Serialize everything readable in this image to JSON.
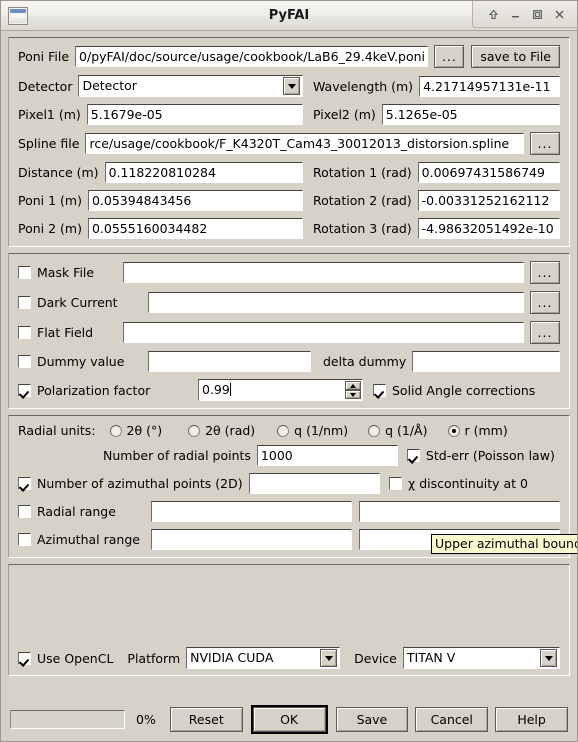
{
  "window": {
    "title": "PyFAI",
    "icon": "window-icon",
    "controls": [
      {
        "name": "shade-button",
        "glyph": "up-arrow-icon"
      },
      {
        "name": "minimize-button",
        "glyph": "minimize-icon"
      },
      {
        "name": "maximize-button",
        "glyph": "maximize-icon"
      },
      {
        "name": "close-button",
        "glyph": "close-icon"
      }
    ]
  },
  "geometry": {
    "poni_file_label": "Poni File",
    "poni_file_value": "0/pyFAI/doc/source/usage/cookbook/LaB6_29.4keV.poni",
    "browse_label": "...",
    "save_to_file_label": "save to File",
    "detector_label": "Detector",
    "detector_value": "Detector",
    "wavelength_label": "Wavelength (m)",
    "wavelength_value": "4.21714957131e-11",
    "pixel1_label": "Pixel1 (m)",
    "pixel1_value": "5.1679e-05",
    "pixel2_label": "Pixel2 (m)",
    "pixel2_value": "5.1265e-05",
    "spline_label": "Spline file",
    "spline_value": "rce/usage/cookbook/F_K4320T_Cam43_30012013_distorsion.spline",
    "distance_label": "Distance (m)",
    "distance_value": "0.118220810284",
    "rotation1_label": "Rotation 1 (rad)",
    "rotation1_value": "0.00697431586749",
    "poni1_label": "Poni 1 (m)",
    "poni1_value": "0.05394843456",
    "rotation2_label": "Rotation 2 (rad)",
    "rotation2_value": "-0.00331252162112",
    "poni2_label": "Poni 2 (m)",
    "poni2_value": "0.0555160034482",
    "rotation3_label": "Rotation 3 (rad)",
    "rotation3_value": "-4.98632051492e-10"
  },
  "corrections": {
    "mask_file_label": "Mask File",
    "mask_file_checked": false,
    "mask_file_value": "",
    "dark_current_label": "Dark Current",
    "dark_current_checked": false,
    "dark_current_value": "",
    "flat_field_label": "Flat Field",
    "flat_field_checked": false,
    "flat_field_value": "",
    "dummy_value_label": "Dummy value",
    "dummy_value_checked": false,
    "dummy_value_value": "",
    "delta_dummy_label": "delta dummy",
    "delta_dummy_value": "",
    "polarization_label": "Polarization factor",
    "polarization_checked": true,
    "polarization_value": "0.99",
    "solid_angle_label": "Solid Angle corrections",
    "solid_angle_checked": true,
    "browse_label": "..."
  },
  "integration": {
    "radial_units_label": "Radial units:",
    "radial_units": [
      {
        "label": "2θ (°)",
        "selected": false
      },
      {
        "label": "2θ (rad)",
        "selected": false
      },
      {
        "label": "q (1/nm)",
        "selected": false
      },
      {
        "label": "q (1/Å)",
        "selected": false
      },
      {
        "label": "r (mm)",
        "selected": true
      }
    ],
    "radial_points_label": "Number of radial points",
    "radial_points_value": "1000",
    "std_err_label": "Std-err (Poisson law)",
    "std_err_checked": true,
    "azimuthal_points_label": "Number of azimuthal points (2D)",
    "azimuthal_points_checked": true,
    "azimuthal_points_value": "",
    "chi_discontinuity_label": "χ discontinuity at 0",
    "chi_discontinuity_checked": false,
    "radial_range_label": "Radial range",
    "radial_range_checked": false,
    "radial_range_min": "",
    "radial_range_max": "",
    "azimuthal_range_label": "Azimuthal range",
    "azimuthal_range_checked": false,
    "azimuthal_range_min": "",
    "azimuthal_range_max": ""
  },
  "tooltip": {
    "text": "Upper azimuthal bound"
  },
  "opencl": {
    "use_opencl_label": "Use OpenCL",
    "use_opencl_checked": true,
    "platform_label": "Platform",
    "platform_value": "NVIDIA CUDA",
    "device_label": "Device",
    "device_value": "TITAN V"
  },
  "bottom": {
    "progress_percent": "0%",
    "reset_label": "Reset",
    "ok_label": "OK",
    "save_label": "Save",
    "cancel_label": "Cancel",
    "help_label": "Help"
  }
}
